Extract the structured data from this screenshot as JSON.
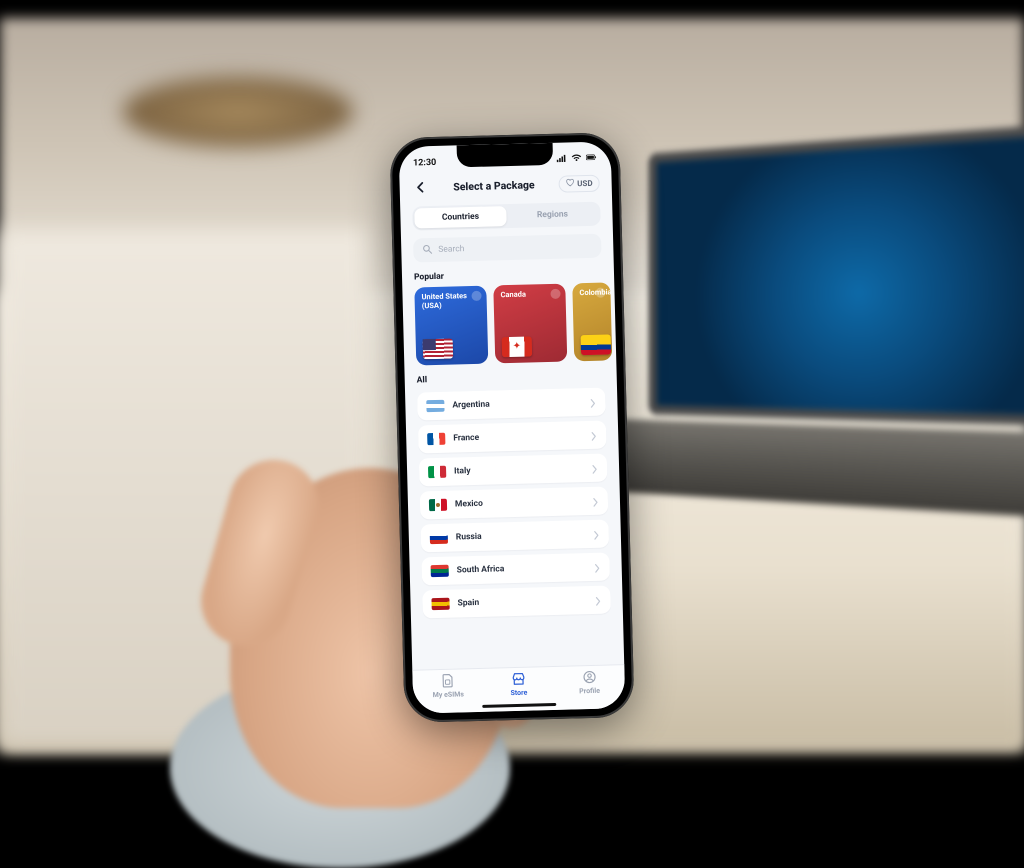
{
  "statusbar": {
    "time": "12:30"
  },
  "header": {
    "title": "Select a Package",
    "currency": "USD"
  },
  "segmented": {
    "countries": "Countries",
    "regions": "Regions"
  },
  "search": {
    "placeholder": "Search"
  },
  "sections": {
    "popular": "Popular",
    "all": "All"
  },
  "popular": [
    {
      "name": "United States (USA)",
      "color": "blue",
      "flag": {
        "stripes": "#b22234",
        "canton": "#3c3b6e"
      }
    },
    {
      "name": "Canada",
      "color": "red",
      "flag": {
        "side": "#d52b1e",
        "center": "#ffffff"
      }
    },
    {
      "name": "Colombia",
      "color": "gold",
      "flag": {
        "top": "#fcd116",
        "mid": "#003893",
        "bot": "#ce1126"
      }
    }
  ],
  "countries": [
    {
      "name": "Argentina",
      "flag": {
        "a": "#74acdf",
        "b": "#ffffff",
        "c": "#74acdf"
      }
    },
    {
      "name": "France",
      "flag": {
        "a": "#0055a4",
        "b": "#ffffff",
        "c": "#ef4135",
        "vertical": true
      }
    },
    {
      "name": "Italy",
      "flag": {
        "a": "#009246",
        "b": "#ffffff",
        "c": "#ce2b37",
        "vertical": true
      }
    },
    {
      "name": "Mexico",
      "flag": {
        "a": "#006847",
        "b": "#ffffff",
        "c": "#ce1126",
        "vertical": true,
        "emblem": "#a06a2c"
      }
    },
    {
      "name": "Russia",
      "flag": {
        "a": "#ffffff",
        "b": "#0039a6",
        "c": "#d52b1e"
      }
    },
    {
      "name": "South Africa",
      "flag": {
        "a": "#de3831",
        "b": "#007a4d",
        "c": "#002395"
      }
    },
    {
      "name": "Spain",
      "flag": {
        "a": "#aa151b",
        "b": "#f1bf00",
        "c": "#aa151b"
      }
    }
  ],
  "tabs": {
    "esims": "My eSIMs",
    "store": "Store",
    "profile": "Profile"
  }
}
